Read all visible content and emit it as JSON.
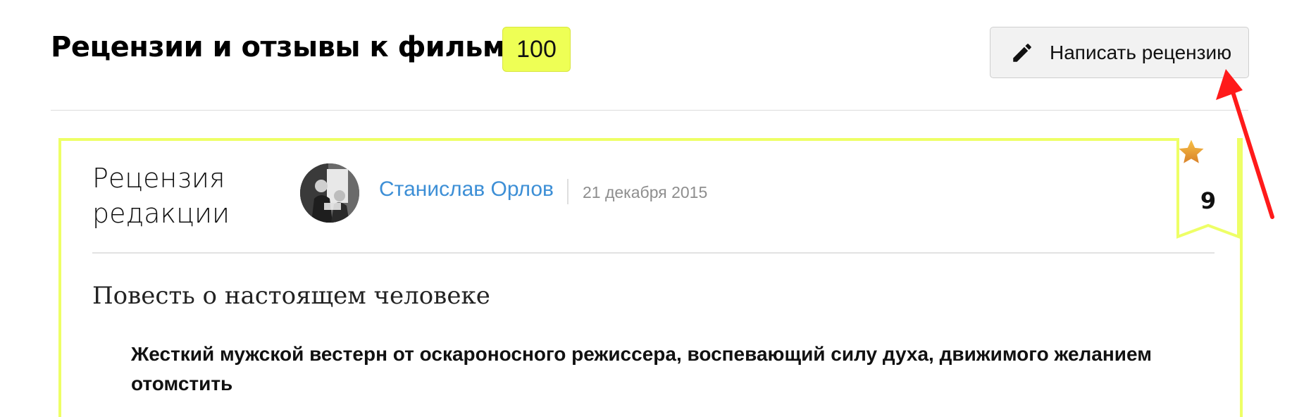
{
  "header": {
    "title": "Рецензии и отзывы к фильму",
    "review_count": "100",
    "write_review_label": "Написать рецензию"
  },
  "review": {
    "type_line1": "Рецензия",
    "type_line2": "редакции",
    "author": "Станислав Орлов",
    "date": "21 декабря 2015",
    "rating": "9",
    "title": "Повесть о настоящем человеке",
    "lead": "Жесткий мужской вестерн от оскароносного режиссера, воспевающий силу духа, движимого желанием отомстить"
  },
  "icons": {
    "write": "pencil-icon",
    "rating": "star-icon",
    "annotation": "arrow-icon"
  },
  "colors": {
    "accent_yellow": "#eeff66",
    "link_blue": "#3d8fd6",
    "annotation_red": "#ff1a1a",
    "star_gold": "#f0a52a"
  }
}
